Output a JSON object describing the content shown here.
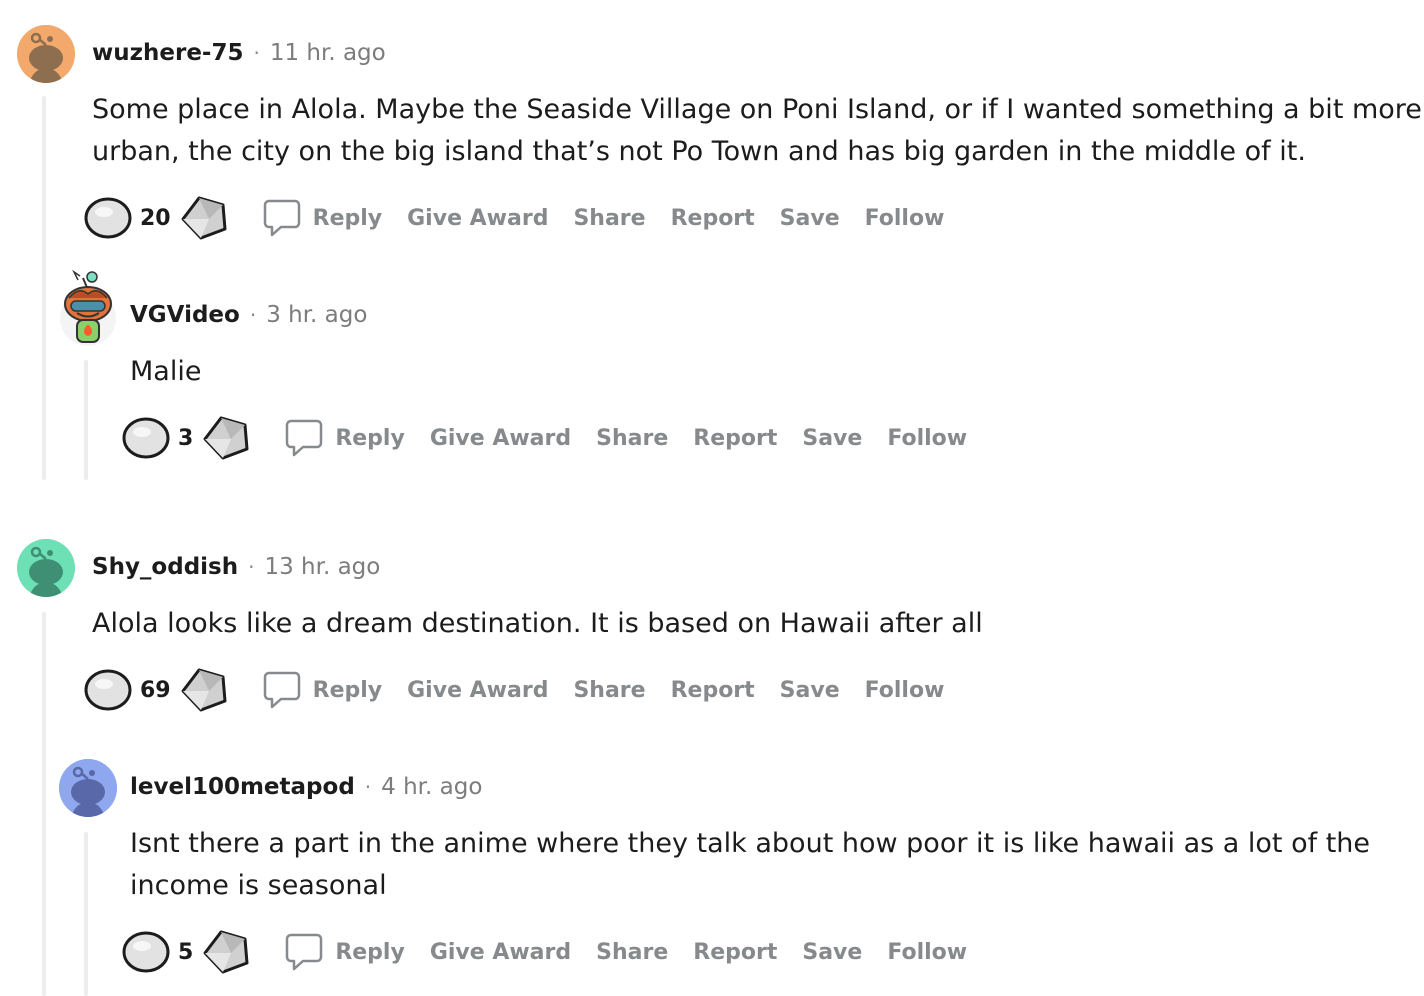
{
  "comments": [
    {
      "username": "wuzhere-75",
      "dot": "·",
      "time": "11 hr. ago",
      "body_lines": [
        "Some place in Alola. Maybe the Seaside Village on Poni Island, or if I wanted something a bit more",
        "urban, the city on the big island that’s not Po Town and has big garden in the middle of it."
      ],
      "score": "20",
      "avatar_color": "#f3a96b",
      "avatar_icon": "snoo-avatar-icon"
    },
    {
      "username": "VGVideo",
      "dot": "·",
      "time": "3 hr. ago",
      "body_lines": [
        "Malie"
      ],
      "score": "3",
      "avatar_icon": "custom-snoo-avatar-icon"
    },
    {
      "username": "Shy_oddish",
      "dot": "·",
      "time": "13 hr. ago",
      "body_lines": [
        "Alola looks like a dream destination. It is based on Hawaii after all"
      ],
      "score": "69",
      "avatar_color": "#6ee0b6",
      "avatar_icon": "snoo-avatar-icon"
    },
    {
      "username": "level100metapod",
      "dot": "·",
      "time": "4 hr. ago",
      "body_lines": [
        "Isnt there a part in the anime where they talk about how poor it is like hawaii as a lot of the",
        "income is seasonal"
      ],
      "score": "5",
      "avatar_color": "#8fa7ee",
      "avatar_icon": "snoo-avatar-icon"
    }
  ],
  "actions": {
    "reply": "Reply",
    "give_award": "Give Award",
    "share": "Share",
    "report": "Report",
    "save": "Save",
    "follow": "Follow"
  },
  "icons": {
    "upvote": "upvote-icon",
    "downvote": "downvote-icon",
    "reply": "comment-bubble-icon"
  },
  "colors": {
    "thread_line": "#ededed",
    "meta_gray": "#7c7c7c",
    "action_gray": "#878a8c",
    "text": "#1c1c1c"
  }
}
